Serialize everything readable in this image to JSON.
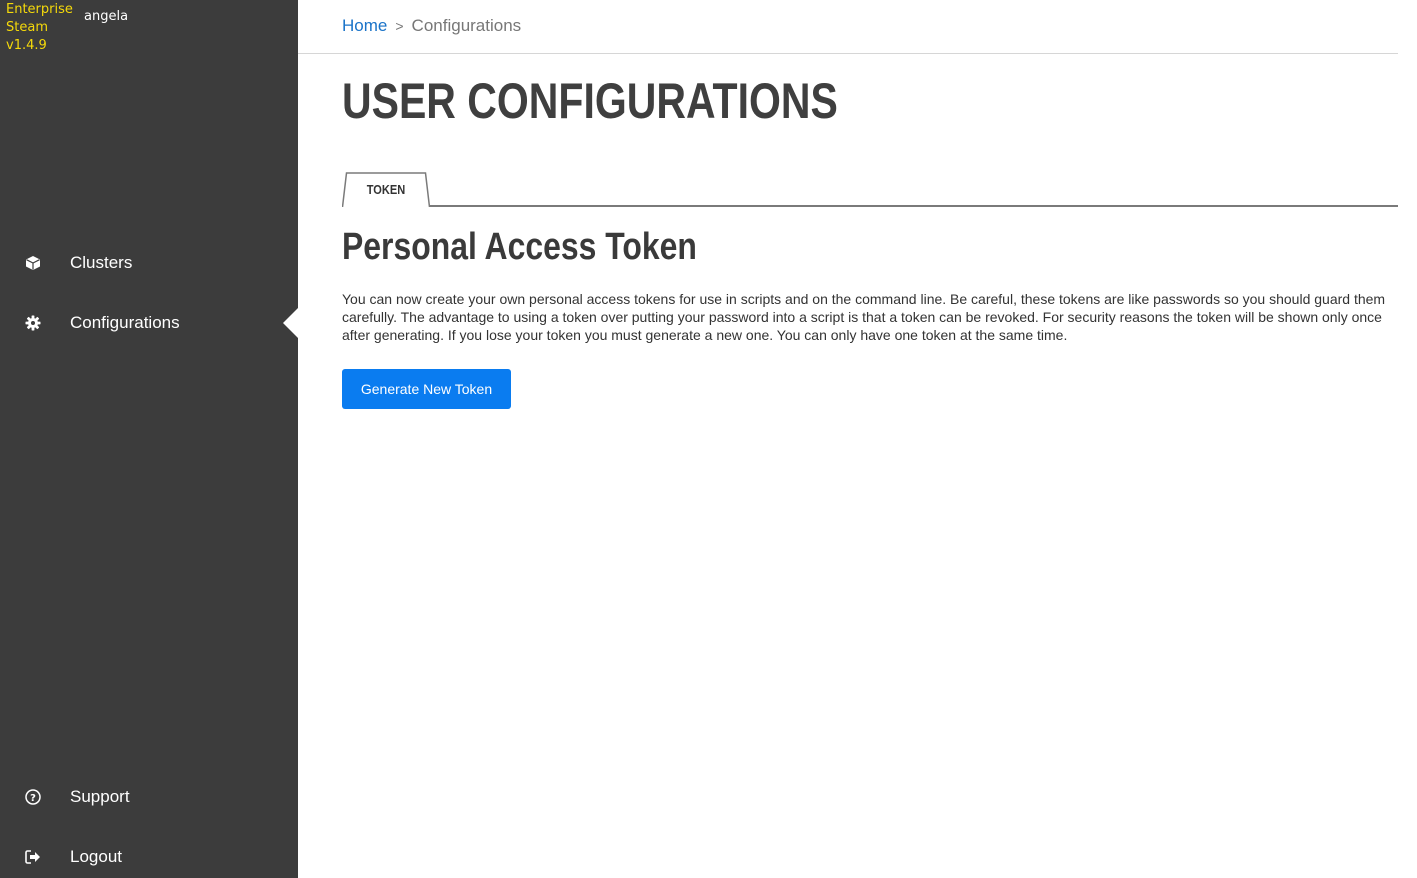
{
  "sidebar": {
    "brand": {
      "line1": "Enterprise",
      "line2": "Steam",
      "version": "v1.4.9"
    },
    "username": "angela",
    "items": [
      {
        "label": "Clusters",
        "icon": "cube-icon"
      },
      {
        "label": "Configurations",
        "icon": "gear-icon",
        "active": true
      },
      {
        "label": "Support",
        "icon": "help-circle-icon"
      },
      {
        "label": "Logout",
        "icon": "logout-icon"
      }
    ]
  },
  "breadcrumb": {
    "home": "Home",
    "separator": ">",
    "current": "Configurations"
  },
  "page": {
    "title": "USER CONFIGURATIONS",
    "tabs": [
      {
        "label": "TOKEN",
        "active": true
      }
    ],
    "section_title": "Personal Access Token",
    "description": "You can now create your own personal access tokens for use in scripts and on the command line. Be careful, these tokens are like passwords so you should guard them carefully. The advantage to using a token over putting your password into a script is that a token can be revoked. For security reasons the token will be shown only once after generating. If you lose your token you must generate a new one. You can only have one token at the same time.",
    "generate_button": "Generate New Token"
  },
  "colors": {
    "sidebar_bg": "#3c3c3c",
    "brand": "#f5d90a",
    "link": "#1a73c8",
    "primary_button": "#0a7cf0"
  }
}
